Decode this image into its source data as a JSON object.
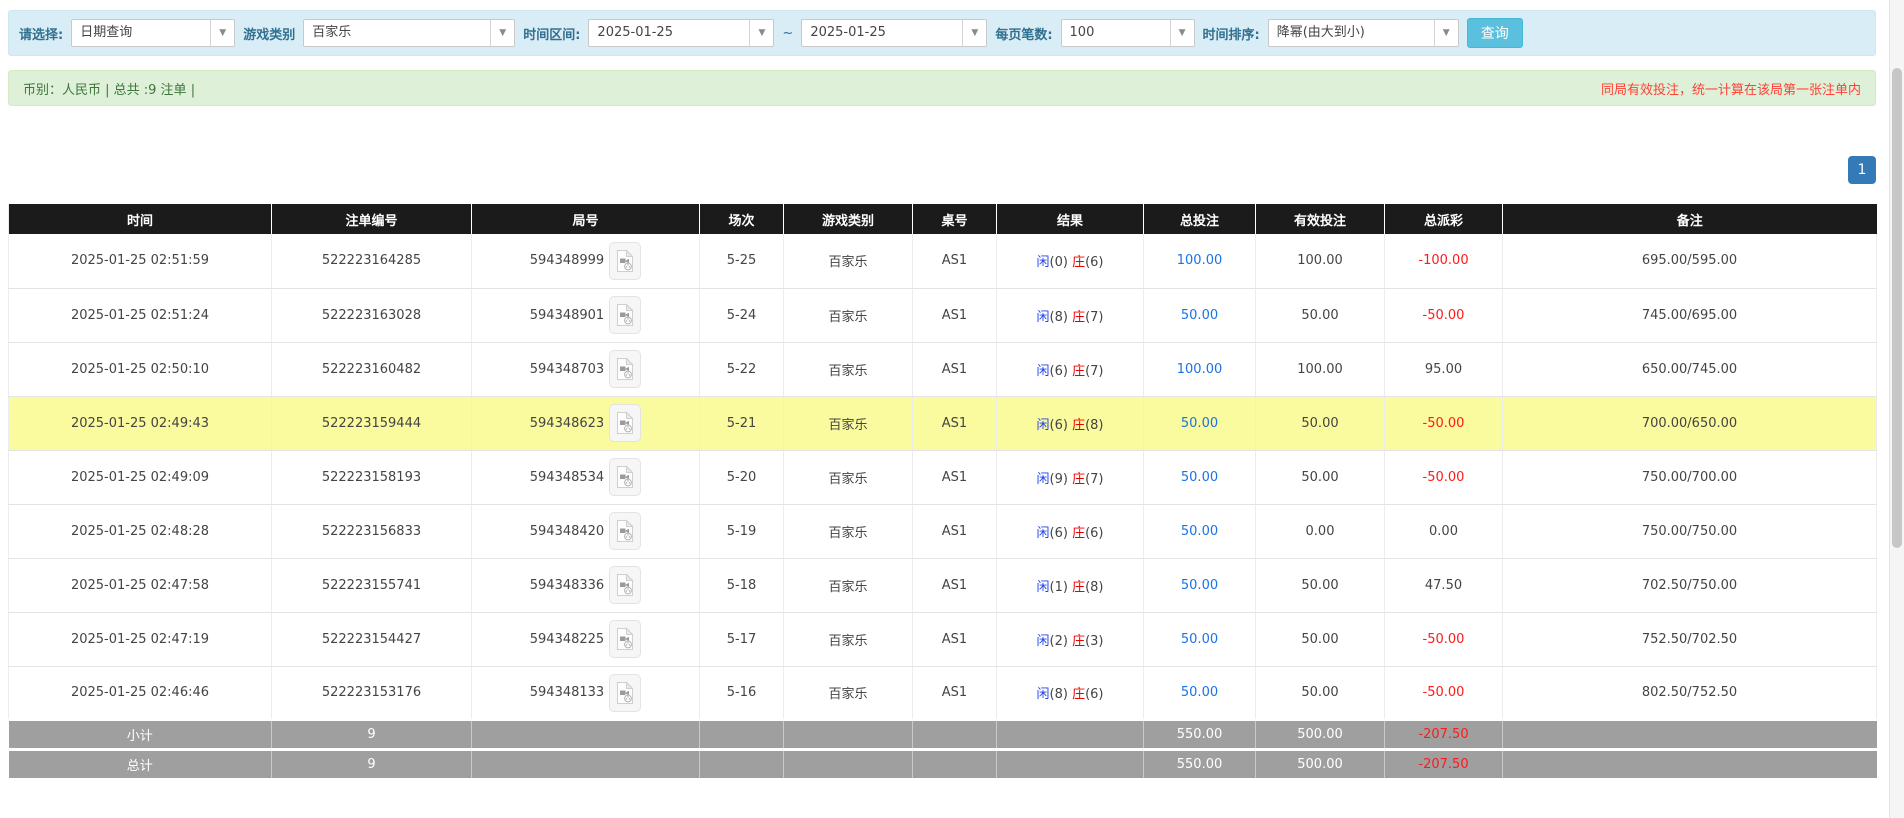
{
  "colors": {
    "accent_blue": "#1a73e8",
    "player_blue": "#2244ee",
    "banker_red": "#e60000",
    "negative_red": "#ff1a1a",
    "notice_red": "#ff4136",
    "button_cyan": "#5bc0de",
    "pagination_blue": "#337ab7",
    "highlight_yellow": "#fafa9e"
  },
  "toolbar": {
    "select_label": "请选择:",
    "select_value": "日期查询",
    "game_label": "游戏类别",
    "game_value": "百家乐",
    "range_label": "时间区间:",
    "range_start": "2025-01-25",
    "range_tilde": "~",
    "range_end": "2025-01-25",
    "pagesize_label": "每页笔数:",
    "pagesize_value": "100",
    "sort_label": "时间排序:",
    "sort_value": "降幂(由大到小)",
    "search_label": "查询",
    "dropdown_arrow": "▼"
  },
  "summary": {
    "left": "币别：人民币 | 总共 :9 注单 |",
    "right_notice": "同局有效投注，统一计算在该局第一张注单内"
  },
  "pagination": {
    "page": "1"
  },
  "table": {
    "headers": [
      "时间",
      "注单编号",
      "局号",
      "场次",
      "游戏类别",
      "桌号",
      "结果",
      "总投注",
      "有效投注",
      "总派彩",
      "备注"
    ],
    "rows": [
      {
        "time": "2025-01-25 02:51:59",
        "bet_id": "522223164285",
        "round_id": "594348999",
        "session": "5-25",
        "game": "百家乐",
        "table": "AS1",
        "player": "闲",
        "player_pts": "(0)",
        "banker": "庄",
        "banker_pts": "(6)",
        "total_bet": "100.00",
        "valid_bet": "100.00",
        "payout": "-100.00",
        "note": "695.00/595.00",
        "highlighted": false
      },
      {
        "time": "2025-01-25 02:51:24",
        "bet_id": "522223163028",
        "round_id": "594348901",
        "session": "5-24",
        "game": "百家乐",
        "table": "AS1",
        "player": "闲",
        "player_pts": "(8)",
        "banker": "庄",
        "banker_pts": "(7)",
        "total_bet": "50.00",
        "valid_bet": "50.00",
        "payout": "-50.00",
        "note": "745.00/695.00",
        "highlighted": false
      },
      {
        "time": "2025-01-25 02:50:10",
        "bet_id": "522223160482",
        "round_id": "594348703",
        "session": "5-22",
        "game": "百家乐",
        "table": "AS1",
        "player": "闲",
        "player_pts": "(6)",
        "banker": "庄",
        "banker_pts": "(7)",
        "total_bet": "100.00",
        "valid_bet": "100.00",
        "payout": "95.00",
        "note": "650.00/745.00",
        "highlighted": false
      },
      {
        "time": "2025-01-25 02:49:43",
        "bet_id": "522223159444",
        "round_id": "594348623",
        "session": "5-21",
        "game": "百家乐",
        "table": "AS1",
        "player": "闲",
        "player_pts": "(6)",
        "banker": "庄",
        "banker_pts": "(8)",
        "total_bet": "50.00",
        "valid_bet": "50.00",
        "payout": "-50.00",
        "note": "700.00/650.00",
        "highlighted": true
      },
      {
        "time": "2025-01-25 02:49:09",
        "bet_id": "522223158193",
        "round_id": "594348534",
        "session": "5-20",
        "game": "百家乐",
        "table": "AS1",
        "player": "闲",
        "player_pts": "(9)",
        "banker": "庄",
        "banker_pts": "(7)",
        "total_bet": "50.00",
        "valid_bet": "50.00",
        "payout": "-50.00",
        "note": "750.00/700.00",
        "highlighted": false
      },
      {
        "time": "2025-01-25 02:48:28",
        "bet_id": "522223156833",
        "round_id": "594348420",
        "session": "5-19",
        "game": "百家乐",
        "table": "AS1",
        "player": "闲",
        "player_pts": "(6)",
        "banker": "庄",
        "banker_pts": "(6)",
        "total_bet": "50.00",
        "valid_bet": "0.00",
        "payout": "0.00",
        "note": "750.00/750.00",
        "highlighted": false
      },
      {
        "time": "2025-01-25 02:47:58",
        "bet_id": "522223155741",
        "round_id": "594348336",
        "session": "5-18",
        "game": "百家乐",
        "table": "AS1",
        "player": "闲",
        "player_pts": "(1)",
        "banker": "庄",
        "banker_pts": "(8)",
        "total_bet": "50.00",
        "valid_bet": "50.00",
        "payout": "47.50",
        "note": "702.50/750.00",
        "highlighted": false
      },
      {
        "time": "2025-01-25 02:47:19",
        "bet_id": "522223154427",
        "round_id": "594348225",
        "session": "5-17",
        "game": "百家乐",
        "table": "AS1",
        "player": "闲",
        "player_pts": "(2)",
        "banker": "庄",
        "banker_pts": "(3)",
        "total_bet": "50.00",
        "valid_bet": "50.00",
        "payout": "-50.00",
        "note": "752.50/702.50",
        "highlighted": false
      },
      {
        "time": "2025-01-25 02:46:46",
        "bet_id": "522223153176",
        "round_id": "594348133",
        "session": "5-16",
        "game": "百家乐",
        "table": "AS1",
        "player": "闲",
        "player_pts": "(8)",
        "banker": "庄",
        "banker_pts": "(6)",
        "total_bet": "50.00",
        "valid_bet": "50.00",
        "payout": "-50.00",
        "note": "802.50/752.50",
        "highlighted": false
      }
    ],
    "subtotal": {
      "label": "小计",
      "count": "9",
      "total_bet": "550.00",
      "valid_bet": "500.00",
      "payout": "-207.50"
    },
    "total": {
      "label": "总计",
      "count": "9",
      "total_bet": "550.00",
      "valid_bet": "500.00",
      "payout": "-207.50"
    }
  }
}
